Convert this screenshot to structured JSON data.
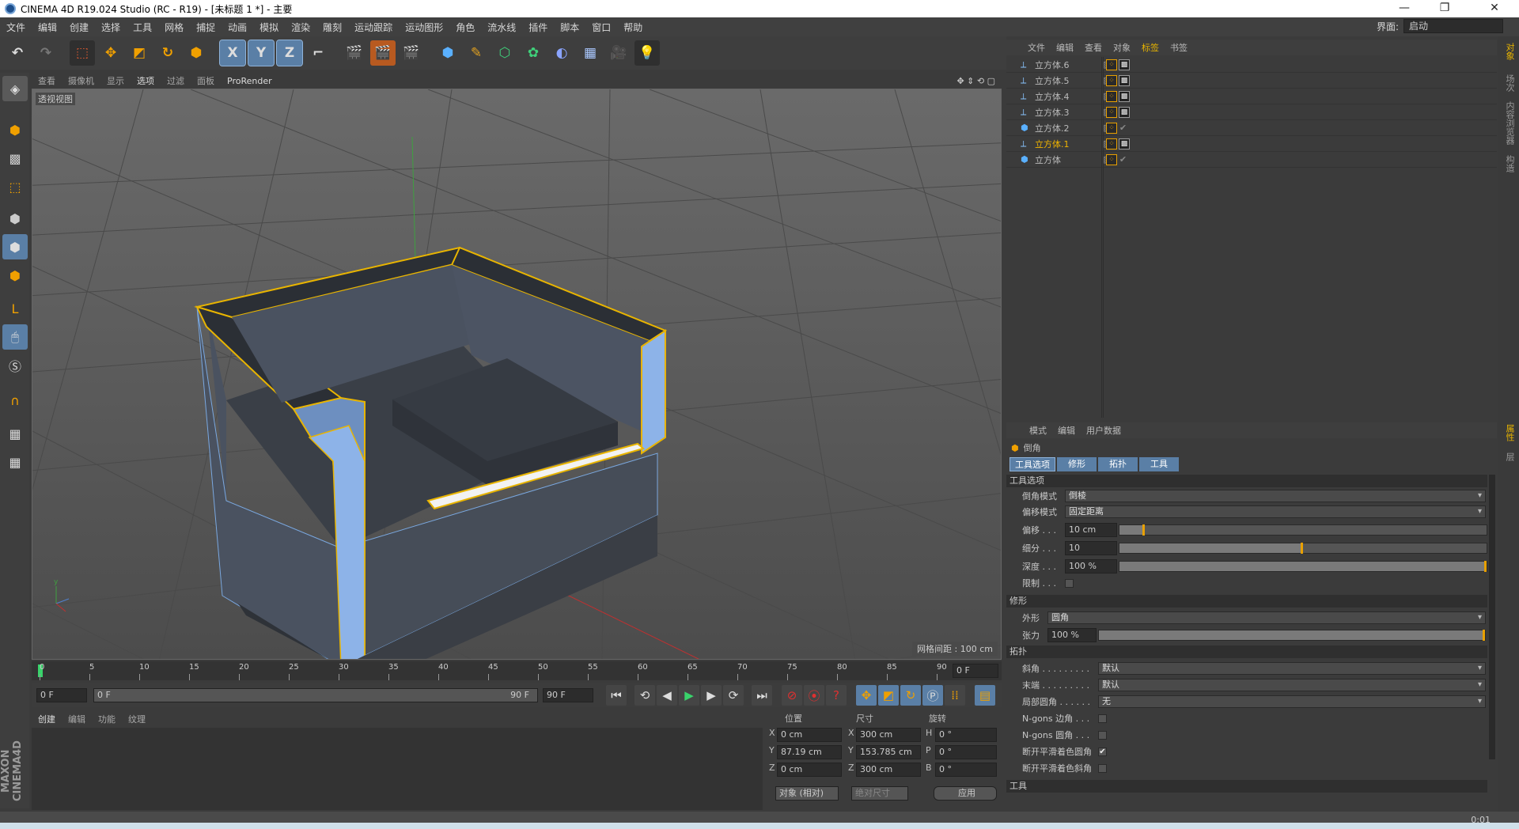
{
  "window": {
    "title": "CINEMA 4D R19.024 Studio (RC - R19) - [未标题 1 *] - 主要",
    "minimize": "—",
    "maximize": "❐",
    "close": "✕"
  },
  "menu": [
    "文件",
    "编辑",
    "创建",
    "选择",
    "工具",
    "网格",
    "捕捉",
    "动画",
    "模拟",
    "渲染",
    "雕刻",
    "运动跟踪",
    "运动图形",
    "角色",
    "流水线",
    "插件",
    "脚本",
    "窗口",
    "帮助"
  ],
  "layout_label": "界面:",
  "layout_value": "启动",
  "toolbar": {
    "undo_icon": "undo-icon",
    "x": "X",
    "y": "Y",
    "z": "Z"
  },
  "viewport": {
    "menu": [
      "查看",
      "摄像机",
      "显示",
      "选项",
      "过滤",
      "面板",
      "ProRender"
    ],
    "label": "透视视图",
    "grid_info": "网格间距 : 100 cm"
  },
  "timeline": {
    "ticks": [
      "0",
      "5",
      "10",
      "15",
      "20",
      "25",
      "30",
      "35",
      "40",
      "45",
      "50",
      "55",
      "60",
      "65",
      "70",
      "75",
      "80",
      "85",
      "90"
    ],
    "end_frame": "0 F"
  },
  "transport": {
    "start": "0 F",
    "range_start": "0 F",
    "range_end": "90 F",
    "end": "90 F"
  },
  "material": {
    "menu": [
      "创建",
      "编辑",
      "功能",
      "纹理"
    ]
  },
  "coords": {
    "headers": [
      "位置",
      "尺寸",
      "旋转"
    ],
    "rows": [
      {
        "axis": "X",
        "pos": "0 cm",
        "size_axis": "X",
        "size": "300 cm",
        "rot_axis": "H",
        "rot": "0 °"
      },
      {
        "axis": "Y",
        "pos": "87.19 cm",
        "size_axis": "Y",
        "size": "153.785 cm",
        "rot_axis": "P",
        "rot": "0 °"
      },
      {
        "axis": "Z",
        "pos": "0 cm",
        "size_axis": "Z",
        "size": "300 cm",
        "rot_axis": "B",
        "rot": "0 °"
      }
    ],
    "mode": "对象 (相对)",
    "size_mode": "绝对尺寸",
    "apply": "应用"
  },
  "brand": "MAXON CINEMA4D",
  "objects": {
    "menu": [
      "文件",
      "编辑",
      "查看",
      "对象",
      "标签",
      "书签"
    ],
    "items": [
      {
        "name": "立方体.6",
        "highlight": false
      },
      {
        "name": "立方体.5",
        "highlight": false
      },
      {
        "name": "立方体.4",
        "highlight": false
      },
      {
        "name": "立方体.3",
        "highlight": false
      },
      {
        "name": "立方体.2",
        "highlight": false
      },
      {
        "name": "立方体.1",
        "highlight": true
      },
      {
        "name": "立方体",
        "highlight": false
      }
    ]
  },
  "attributes": {
    "menu": [
      "模式",
      "编辑",
      "用户数据"
    ],
    "tool_name": "倒角",
    "tabs": [
      "工具选项",
      "修形",
      "拓扑",
      "工具"
    ],
    "sections": {
      "tool_options": "工具选项",
      "shaping": "修形",
      "topology": "拓扑",
      "tool": "工具"
    },
    "bevel_mode_label": "倒角模式",
    "bevel_mode": "倒棱",
    "offset_mode_label": "偏移模式",
    "offset_mode": "固定距离",
    "offset_label": "偏移 . . .",
    "offset": "10 cm",
    "offset_frac": 0.07,
    "subdiv_label": "细分 . . .",
    "subdiv": "10",
    "subdiv_frac": 0.5,
    "depth_label": "深度 . . .",
    "depth": "100 %",
    "depth_frac": 1.0,
    "limit_label": "限制 . . .",
    "shape_label": "外形",
    "shape": "圆角",
    "tension_label": "张力",
    "tension": "100 %",
    "tension_frac": 1.0,
    "miter_label": "斜角 . . . . . . . . .",
    "miter": "默认",
    "end_label": "末端 . . . . . . . . .",
    "end": "默认",
    "partial_label": "局部圆角 . . . . . .",
    "partial": "无",
    "ngon_corner_label": "N-gons 边角 . . .",
    "ngon_round_label": "N-gons 圆角 . . .",
    "break_round_label": "断开平滑着色圆角",
    "break_miter_label": "断开平滑着色斜角"
  },
  "right_tabs": [
    "对象",
    "场次",
    "内容浏览器",
    "构造",
    "属性",
    "层"
  ],
  "status": {
    "value": "0:01"
  },
  "colors": {
    "accent": "#e8a000",
    "selection_blue": "#5a7fa6",
    "highlight_text": "#f0b400"
  }
}
